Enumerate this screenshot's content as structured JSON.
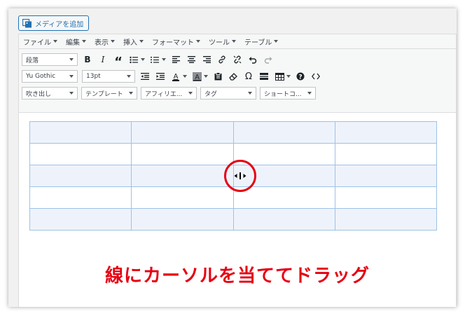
{
  "media_button": {
    "label": "メディアを追加"
  },
  "menubar": [
    {
      "name": "menu-file",
      "label": "ファイル"
    },
    {
      "name": "menu-edit",
      "label": "編集"
    },
    {
      "name": "menu-view",
      "label": "表示"
    },
    {
      "name": "menu-insert",
      "label": "挿入"
    },
    {
      "name": "menu-format",
      "label": "フォーマット"
    },
    {
      "name": "menu-tools",
      "label": "ツール"
    },
    {
      "name": "menu-table",
      "label": "テーブル"
    }
  ],
  "toolbar": {
    "format_select": "段落",
    "font_family_select": "Yu Gothic",
    "font_size_select": "13pt",
    "bold": "B",
    "italic": "I",
    "blockquote": "“",
    "omega": "Ω"
  },
  "toolbar3": {
    "balloon_select": "吹き出し",
    "template_select": "テンプレート",
    "affiliate_select": "アフィリエ...",
    "tag_select": "タグ",
    "shortcode_select": "ショートコ..."
  },
  "caption": "線にカーソルを当ててドラッグ",
  "colors": {
    "accent": "#2271b1",
    "highlight": "#e60012",
    "table_border": "#9ec2e6",
    "table_stripe": "#eef3fb"
  },
  "table": {
    "rows": 5,
    "cols": 4
  }
}
